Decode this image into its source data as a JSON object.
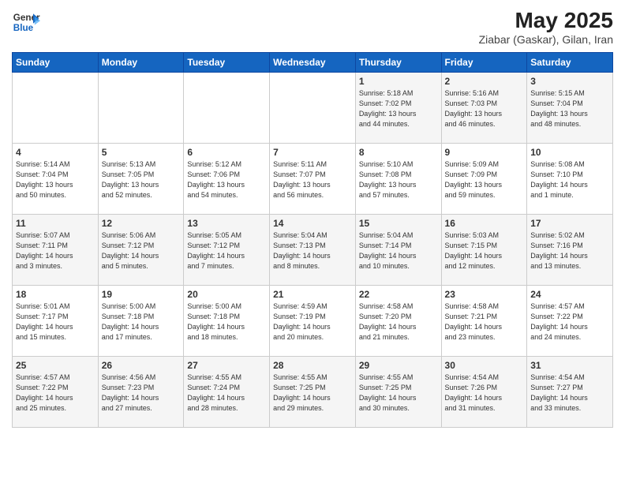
{
  "header": {
    "logo_line1": "General",
    "logo_line2": "Blue",
    "month": "May 2025",
    "location": "Ziabar (Gaskar), Gilan, Iran"
  },
  "weekdays": [
    "Sunday",
    "Monday",
    "Tuesday",
    "Wednesday",
    "Thursday",
    "Friday",
    "Saturday"
  ],
  "weeks": [
    [
      {
        "day": "",
        "info": ""
      },
      {
        "day": "",
        "info": ""
      },
      {
        "day": "",
        "info": ""
      },
      {
        "day": "",
        "info": ""
      },
      {
        "day": "1",
        "info": "Sunrise: 5:18 AM\nSunset: 7:02 PM\nDaylight: 13 hours\nand 44 minutes."
      },
      {
        "day": "2",
        "info": "Sunrise: 5:16 AM\nSunset: 7:03 PM\nDaylight: 13 hours\nand 46 minutes."
      },
      {
        "day": "3",
        "info": "Sunrise: 5:15 AM\nSunset: 7:04 PM\nDaylight: 13 hours\nand 48 minutes."
      }
    ],
    [
      {
        "day": "4",
        "info": "Sunrise: 5:14 AM\nSunset: 7:04 PM\nDaylight: 13 hours\nand 50 minutes."
      },
      {
        "day": "5",
        "info": "Sunrise: 5:13 AM\nSunset: 7:05 PM\nDaylight: 13 hours\nand 52 minutes."
      },
      {
        "day": "6",
        "info": "Sunrise: 5:12 AM\nSunset: 7:06 PM\nDaylight: 13 hours\nand 54 minutes."
      },
      {
        "day": "7",
        "info": "Sunrise: 5:11 AM\nSunset: 7:07 PM\nDaylight: 13 hours\nand 56 minutes."
      },
      {
        "day": "8",
        "info": "Sunrise: 5:10 AM\nSunset: 7:08 PM\nDaylight: 13 hours\nand 57 minutes."
      },
      {
        "day": "9",
        "info": "Sunrise: 5:09 AM\nSunset: 7:09 PM\nDaylight: 13 hours\nand 59 minutes."
      },
      {
        "day": "10",
        "info": "Sunrise: 5:08 AM\nSunset: 7:10 PM\nDaylight: 14 hours\nand 1 minute."
      }
    ],
    [
      {
        "day": "11",
        "info": "Sunrise: 5:07 AM\nSunset: 7:11 PM\nDaylight: 14 hours\nand 3 minutes."
      },
      {
        "day": "12",
        "info": "Sunrise: 5:06 AM\nSunset: 7:12 PM\nDaylight: 14 hours\nand 5 minutes."
      },
      {
        "day": "13",
        "info": "Sunrise: 5:05 AM\nSunset: 7:12 PM\nDaylight: 14 hours\nand 7 minutes."
      },
      {
        "day": "14",
        "info": "Sunrise: 5:04 AM\nSunset: 7:13 PM\nDaylight: 14 hours\nand 8 minutes."
      },
      {
        "day": "15",
        "info": "Sunrise: 5:04 AM\nSunset: 7:14 PM\nDaylight: 14 hours\nand 10 minutes."
      },
      {
        "day": "16",
        "info": "Sunrise: 5:03 AM\nSunset: 7:15 PM\nDaylight: 14 hours\nand 12 minutes."
      },
      {
        "day": "17",
        "info": "Sunrise: 5:02 AM\nSunset: 7:16 PM\nDaylight: 14 hours\nand 13 minutes."
      }
    ],
    [
      {
        "day": "18",
        "info": "Sunrise: 5:01 AM\nSunset: 7:17 PM\nDaylight: 14 hours\nand 15 minutes."
      },
      {
        "day": "19",
        "info": "Sunrise: 5:00 AM\nSunset: 7:18 PM\nDaylight: 14 hours\nand 17 minutes."
      },
      {
        "day": "20",
        "info": "Sunrise: 5:00 AM\nSunset: 7:18 PM\nDaylight: 14 hours\nand 18 minutes."
      },
      {
        "day": "21",
        "info": "Sunrise: 4:59 AM\nSunset: 7:19 PM\nDaylight: 14 hours\nand 20 minutes."
      },
      {
        "day": "22",
        "info": "Sunrise: 4:58 AM\nSunset: 7:20 PM\nDaylight: 14 hours\nand 21 minutes."
      },
      {
        "day": "23",
        "info": "Sunrise: 4:58 AM\nSunset: 7:21 PM\nDaylight: 14 hours\nand 23 minutes."
      },
      {
        "day": "24",
        "info": "Sunrise: 4:57 AM\nSunset: 7:22 PM\nDaylight: 14 hours\nand 24 minutes."
      }
    ],
    [
      {
        "day": "25",
        "info": "Sunrise: 4:57 AM\nSunset: 7:22 PM\nDaylight: 14 hours\nand 25 minutes."
      },
      {
        "day": "26",
        "info": "Sunrise: 4:56 AM\nSunset: 7:23 PM\nDaylight: 14 hours\nand 27 minutes."
      },
      {
        "day": "27",
        "info": "Sunrise: 4:55 AM\nSunset: 7:24 PM\nDaylight: 14 hours\nand 28 minutes."
      },
      {
        "day": "28",
        "info": "Sunrise: 4:55 AM\nSunset: 7:25 PM\nDaylight: 14 hours\nand 29 minutes."
      },
      {
        "day": "29",
        "info": "Sunrise: 4:55 AM\nSunset: 7:25 PM\nDaylight: 14 hours\nand 30 minutes."
      },
      {
        "day": "30",
        "info": "Sunrise: 4:54 AM\nSunset: 7:26 PM\nDaylight: 14 hours\nand 31 minutes."
      },
      {
        "day": "31",
        "info": "Sunrise: 4:54 AM\nSunset: 7:27 PM\nDaylight: 14 hours\nand 33 minutes."
      }
    ]
  ]
}
